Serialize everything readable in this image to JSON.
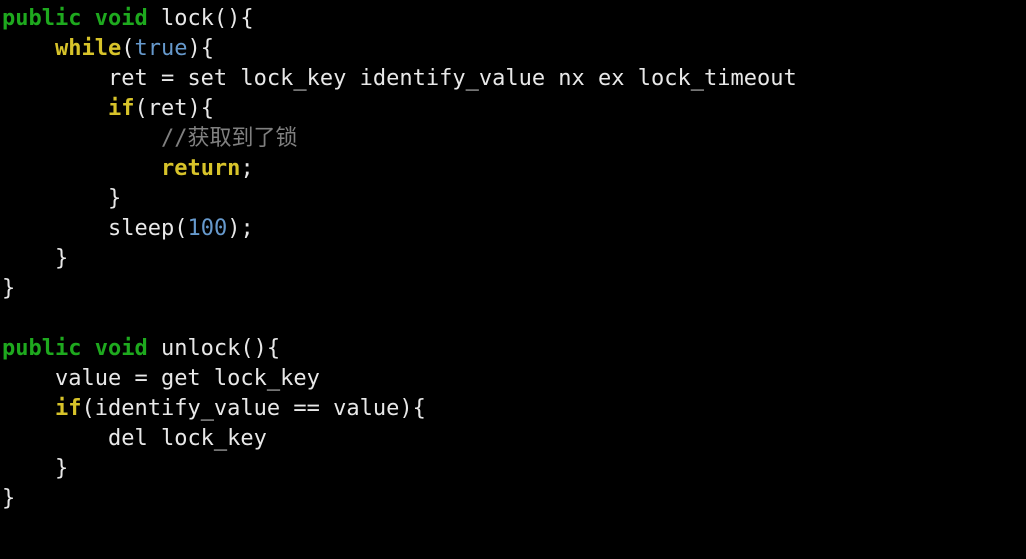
{
  "code": {
    "lock_decl_mod": "public void",
    "lock_decl_name": " lock(){",
    "while_kw": "while",
    "while_open": "(",
    "true_lit": "true",
    "while_close": "){",
    "ret_line": "ret = set lock_key identify_value nx ex lock_timeout",
    "if_kw": "if",
    "if_cond": "(ret){",
    "comment": "//获取到了锁",
    "return_kw": "return",
    "semicolon": ";",
    "close_brace": "}",
    "sleep_open": "sleep(",
    "sleep_arg": "100",
    "sleep_close": ");",
    "unlock_decl_mod": "public void",
    "unlock_decl_name": " unlock(){",
    "value_line": "value = get lock_key",
    "if2_cond": "(identify_value == value){",
    "del_line": "del lock_key"
  }
}
